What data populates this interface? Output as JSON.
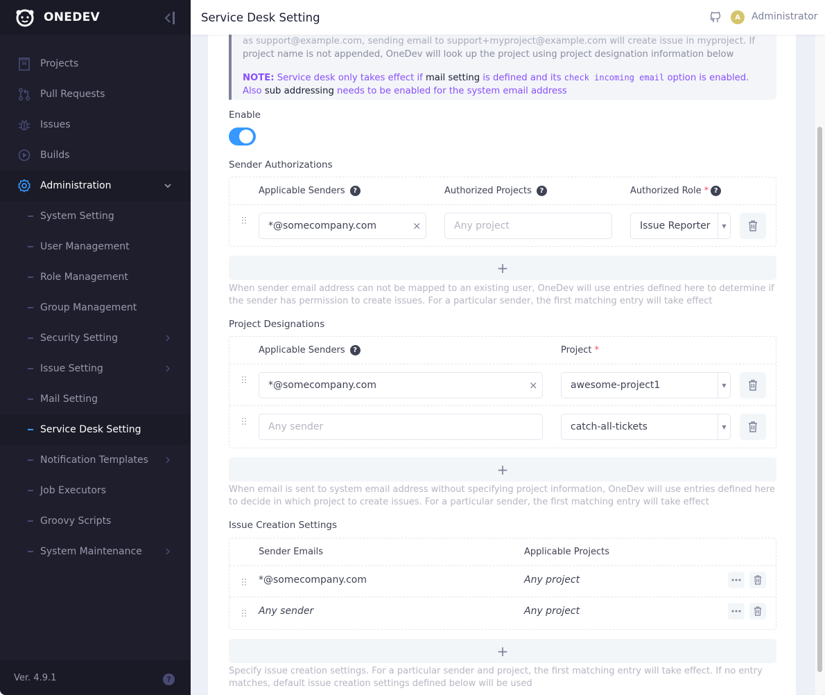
{
  "app": {
    "brand": "ONEDEV",
    "version": "Ver. 4.9.1"
  },
  "header": {
    "title": "Service Desk Setting",
    "user_initial": "A",
    "user_name": "Administrator"
  },
  "sidebar": {
    "items": [
      {
        "label": "Projects",
        "icon": "book-icon"
      },
      {
        "label": "Pull Requests",
        "icon": "pull-request-icon"
      },
      {
        "label": "Issues",
        "icon": "bug-icon"
      },
      {
        "label": "Builds",
        "icon": "play-circle-icon"
      },
      {
        "label": "Administration",
        "icon": "gear-icon",
        "expanded": true
      }
    ],
    "admin_items": [
      {
        "label": "System Setting",
        "has_children": false
      },
      {
        "label": "User Management",
        "has_children": false
      },
      {
        "label": "Role Management",
        "has_children": false
      },
      {
        "label": "Group Management",
        "has_children": false
      },
      {
        "label": "Security Setting",
        "has_children": true
      },
      {
        "label": "Issue Setting",
        "has_children": true
      },
      {
        "label": "Mail Setting",
        "has_children": false
      },
      {
        "label": "Service Desk Setting",
        "has_children": false,
        "active": true
      },
      {
        "label": "Notification Templates",
        "has_children": true
      },
      {
        "label": "Job Executors",
        "has_children": false
      },
      {
        "label": "Groovy Scripts",
        "has_children": false
      },
      {
        "label": "System Maintenance",
        "has_children": true
      }
    ]
  },
  "alert": {
    "clipped_line": "as support@example.com, sending email to support+myproject@example.com will create issue in myproject. If",
    "line2": "project name is not appended, OneDev will look up the project using project designation information below",
    "note_label": "NOTE:",
    "note_part1": " Service desk only takes effect if ",
    "note_link1": "mail setting",
    "note_part2": " is defined and its ",
    "note_code": "check incoming email",
    "note_part3": " option is enabled. Also ",
    "note_link2": "sub addressing",
    "note_part4": " needs to be enabled for the system email address"
  },
  "enable": {
    "label": "Enable",
    "value": true
  },
  "sender_authorizations": {
    "title": "Sender Authorizations",
    "columns": [
      "Applicable Senders",
      "Authorized Projects",
      "Authorized Role"
    ],
    "rows": [
      {
        "senders": "*@somecompany.com",
        "projects_placeholder": "Any project",
        "role": "Issue Reporter"
      }
    ],
    "add_label": "+",
    "help": "When sender email address can not be mapped to an existing user, OneDev will use entries defined here to determine if the sender has permission to create issues. For a particular sender, the first matching entry will take effect"
  },
  "project_designations": {
    "title": "Project Designations",
    "columns": [
      "Applicable Senders",
      "Project"
    ],
    "rows": [
      {
        "senders": "*@somecompany.com",
        "senders_placeholder": "",
        "project": "awesome-project1"
      },
      {
        "senders": "",
        "senders_placeholder": "Any sender",
        "project": "catch-all-tickets"
      }
    ],
    "add_label": "+",
    "help": "When email is sent to system email address without specifying project information, OneDev will use entries defined here to decide in which project to create issues. For a particular sender, the first matching entry will take effect"
  },
  "issue_creation": {
    "title": "Issue Creation Settings",
    "columns": [
      "Sender Emails",
      "Applicable Projects"
    ],
    "rows": [
      {
        "senders": "*@somecompany.com",
        "projects": "Any project"
      },
      {
        "senders": "Any sender",
        "projects": "Any project"
      }
    ],
    "add_label": "+",
    "help": "Specify issue creation settings. For a particular sender and project, the first matching entry will take effect. If no entry matches, default issue creation settings defined below will be used"
  }
}
